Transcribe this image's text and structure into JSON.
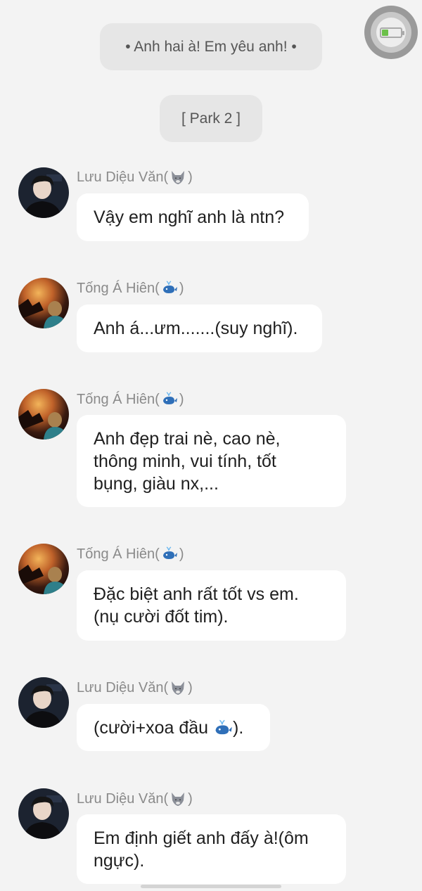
{
  "chat": {
    "title_pill": "• Anh hai à! Em yêu anh! •",
    "part_pill": "[ Park 2 ]",
    "messages": [
      {
        "sender": "Lưu Diệu Văn(",
        "sender_end": ")",
        "emoji": "wolf-emoji",
        "avatar": "boy-avatar",
        "text": "Vậy em nghĩ anh là ntn?"
      },
      {
        "sender": "Tống Á Hiên(",
        "sender_end": ")",
        "emoji": "whale-emoji",
        "avatar": "sunset-avatar",
        "text": "Anh á...ưm.......(suy nghĩ)."
      },
      {
        "sender": "Tống Á Hiên(",
        "sender_end": ")",
        "emoji": "whale-emoji",
        "avatar": "sunset-avatar",
        "text": "Anh đẹp trai nè, cao nè,\nthông minh, vui tính, tốt\nbụng, giàu nx,..."
      },
      {
        "sender": "Tống Á Hiên(",
        "sender_end": ")",
        "emoji": "whale-emoji",
        "avatar": "sunset-avatar",
        "text": "Đặc biệt anh rất tốt vs em.\n(nụ cười đốt tim)."
      },
      {
        "sender": "Lưu Diệu Văn(",
        "sender_end": ")",
        "emoji": "wolf-emoji",
        "avatar": "boy-avatar",
        "text_before": "(cười+xoa đầu ",
        "text_after": ")."
      },
      {
        "sender": "Lưu Diệu Văn(",
        "sender_end": ")",
        "emoji": "wolf-emoji",
        "avatar": "boy-avatar",
        "text": "Em định giết anh đấy à!(ôm\nngực)."
      }
    ]
  },
  "colors": {
    "background": "#f3f3f3",
    "bubble": "#ffffff",
    "pill": "#e6e6e6",
    "sender_text": "#8a8a8a"
  }
}
